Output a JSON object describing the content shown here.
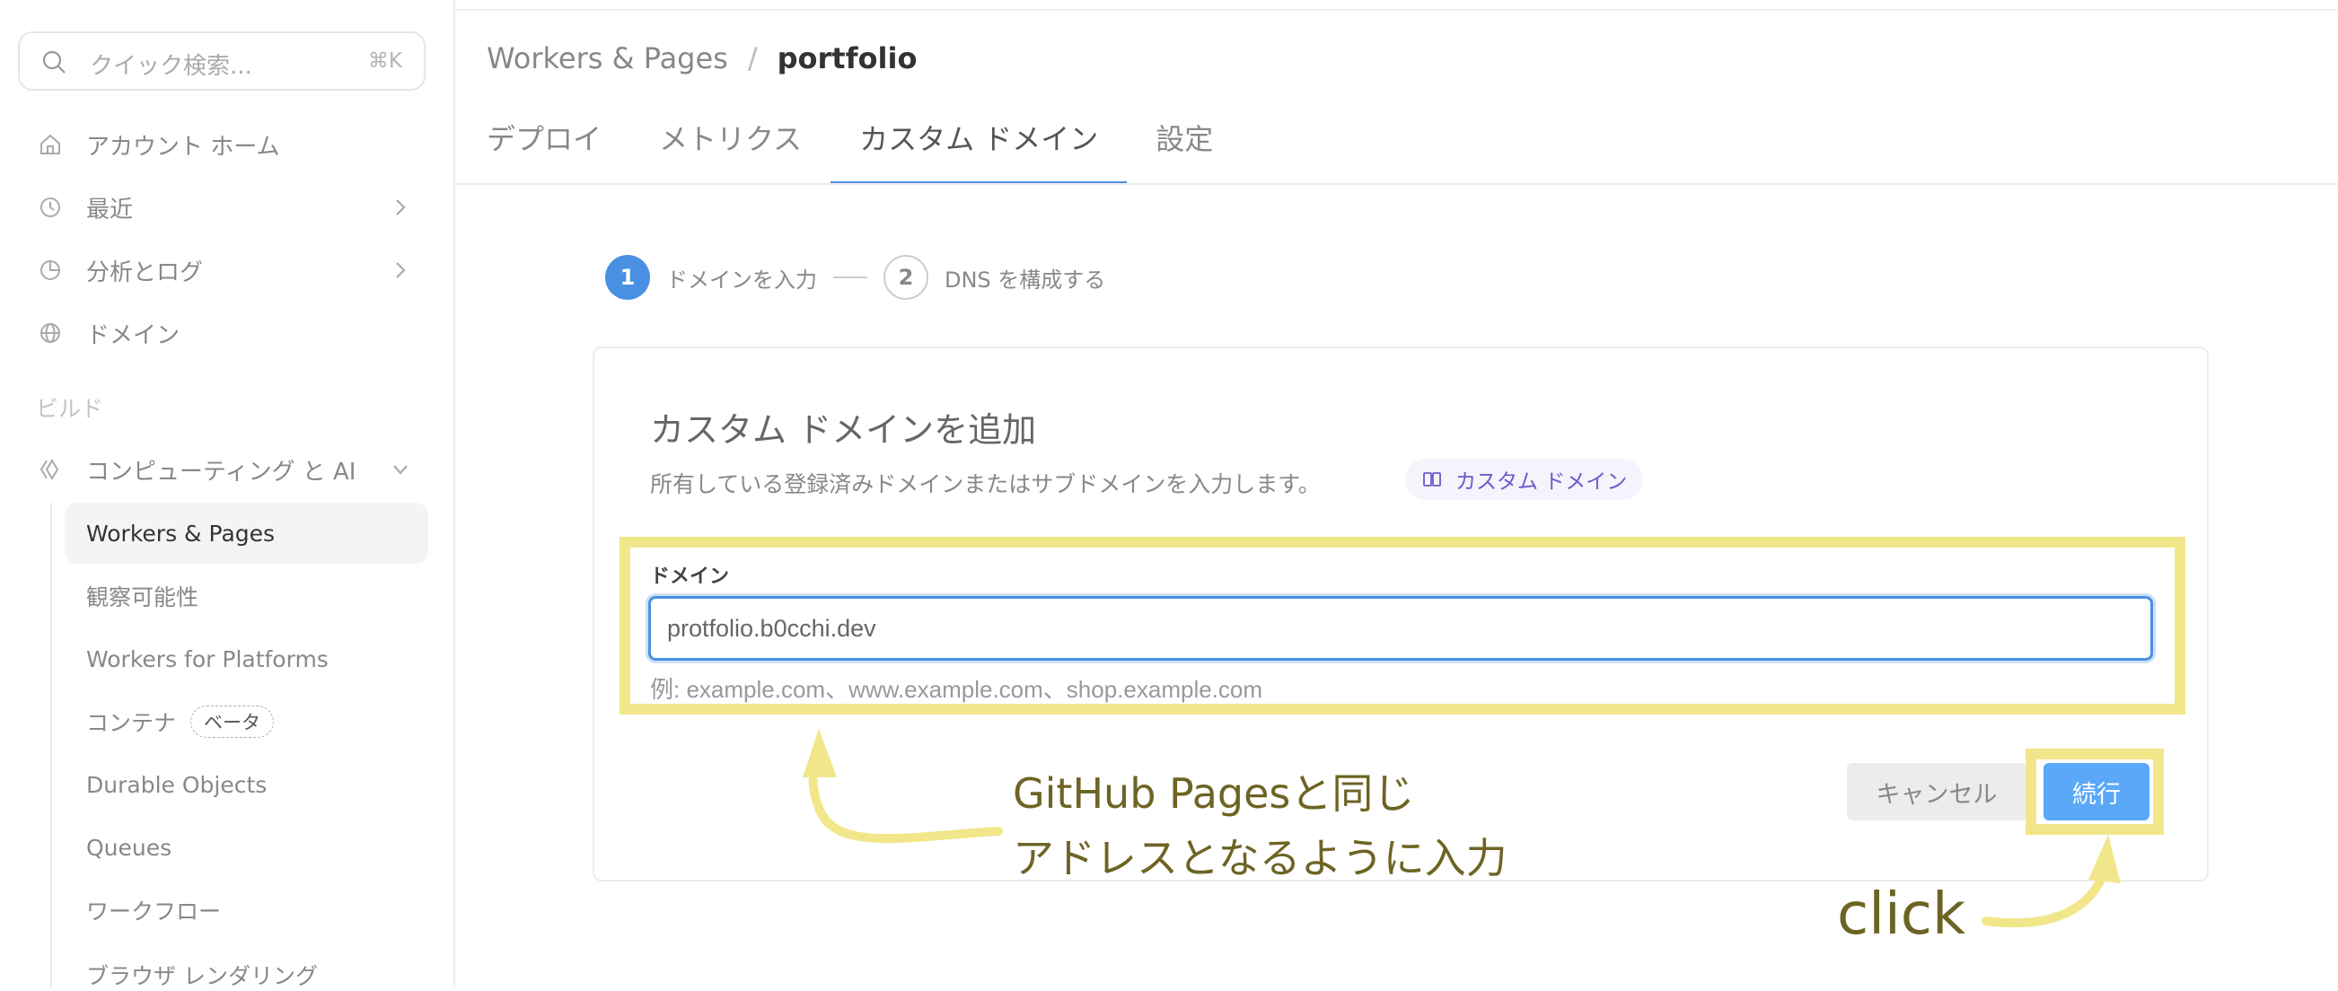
{
  "sidebar": {
    "search": {
      "placeholder": "クイック検索...",
      "shortcut": "⌘K"
    },
    "items": [
      {
        "label": "アカウント ホーム",
        "icon": "home-icon"
      },
      {
        "label": "最近",
        "icon": "history-icon",
        "has_chevron": true
      },
      {
        "label": "分析とログ",
        "icon": "pie-chart-icon",
        "has_chevron": true
      },
      {
        "label": "ドメイン",
        "icon": "globe-icon"
      }
    ],
    "section_label": "ビルド",
    "group": {
      "label": "コンピューティング と AI",
      "icon": "compute-icon",
      "expanded": true
    },
    "sub_items": [
      {
        "label": "Workers & Pages",
        "active": true
      },
      {
        "label": "観察可能性"
      },
      {
        "label": "Workers for Platforms"
      },
      {
        "label": "コンテナ",
        "badge": "ベータ"
      },
      {
        "label": "Durable Objects"
      },
      {
        "label": "Queues"
      },
      {
        "label": "ワークフロー"
      },
      {
        "label": "ブラウザ レンダリング"
      }
    ]
  },
  "header": {
    "breadcrumb": {
      "parent": "Workers & Pages",
      "separator": "/",
      "current": "portfolio"
    },
    "tabs": [
      "デプロイ",
      "メトリクス",
      "カスタム ドメイン",
      "設定"
    ],
    "active_tab": "カスタム ドメイン"
  },
  "stepper": {
    "steps": [
      {
        "number": "1",
        "label": "ドメインを入力",
        "active": true
      },
      {
        "number": "2",
        "label": "DNS を構成する",
        "active": false
      }
    ]
  },
  "card": {
    "title": "カスタム ドメインを追加",
    "description": "所有している登録済みドメインまたはサブドメインを入力します。",
    "doc_link": "カスタム ドメイン",
    "field_label": "ドメイン",
    "field_value": "protfolio.b0cchi.dev",
    "field_hint": "例: example.com、www.example.com、shop.example.com",
    "cancel_label": "キャンセル",
    "continue_label": "続行"
  },
  "annotations": {
    "note_line1": "GitHub Pagesと同じ",
    "note_line2": "アドレスとなるように入力",
    "click": "click",
    "highlight_color": "#f1e78a",
    "text_color": "#6d6424"
  },
  "colors": {
    "accent": "#4a90e2",
    "primary_button": "#5aa8f7",
    "doc_link_text": "#6a5ac9"
  }
}
